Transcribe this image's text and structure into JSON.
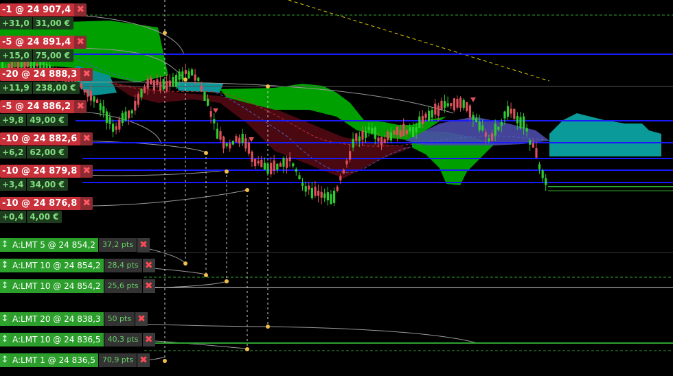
{
  "positions": [
    {
      "label": "-1 @ 24 907,4",
      "pnl": "+31,0",
      "amount": "31,00 €"
    },
    {
      "label": "-5 @ 24 891,4",
      "pnl": "+15,0",
      "amount": "75,00 €"
    },
    {
      "label": "-20 @ 24 888,3",
      "pnl": "+11,9",
      "amount": "238,00 €"
    },
    {
      "label": "-5 @ 24 886,2",
      "pnl": "+9,8",
      "amount": "49,00 €"
    },
    {
      "label": "-10 @ 24 882,6",
      "pnl": "+6,2",
      "amount": "62,00 €"
    },
    {
      "label": "-10 @ 24 879,8",
      "pnl": "+3,4",
      "amount": "34,00 €"
    },
    {
      "label": "-10 @ 24 876,8",
      "pnl": "+0,4",
      "amount": "4,00 €"
    }
  ],
  "orders": [
    {
      "label": "A:LMT 5 @ 24 854,2",
      "pts": "37,2 pts"
    },
    {
      "label": "A:LMT 10 @ 24 854,2",
      "pts": "28,4 pts"
    },
    {
      "label": "A:LMT 10 @ 24 854,2",
      "pts": "25,6 pts"
    },
    {
      "label": "A:LMT 20 @ 24 838,3",
      "pts": "50 pts"
    },
    {
      "label": "A:LMT 10 @ 24 836,5",
      "pts": "40,3 pts"
    },
    {
      "label": "A:LMT 1 @ 24 836,5",
      "pts": "70,9 pts"
    }
  ],
  "icons": {
    "close": "✖",
    "drag": "↕"
  },
  "colors": {
    "bull_candle": "#2ecc2e",
    "bear_candle": "#e0505a",
    "position_line": "#1a1aff",
    "cloud_green": "#00a000",
    "cloud_red": "#5a0a14",
    "cloud_teal": "#0a9a9a",
    "order_line": "#2ea32e"
  }
}
